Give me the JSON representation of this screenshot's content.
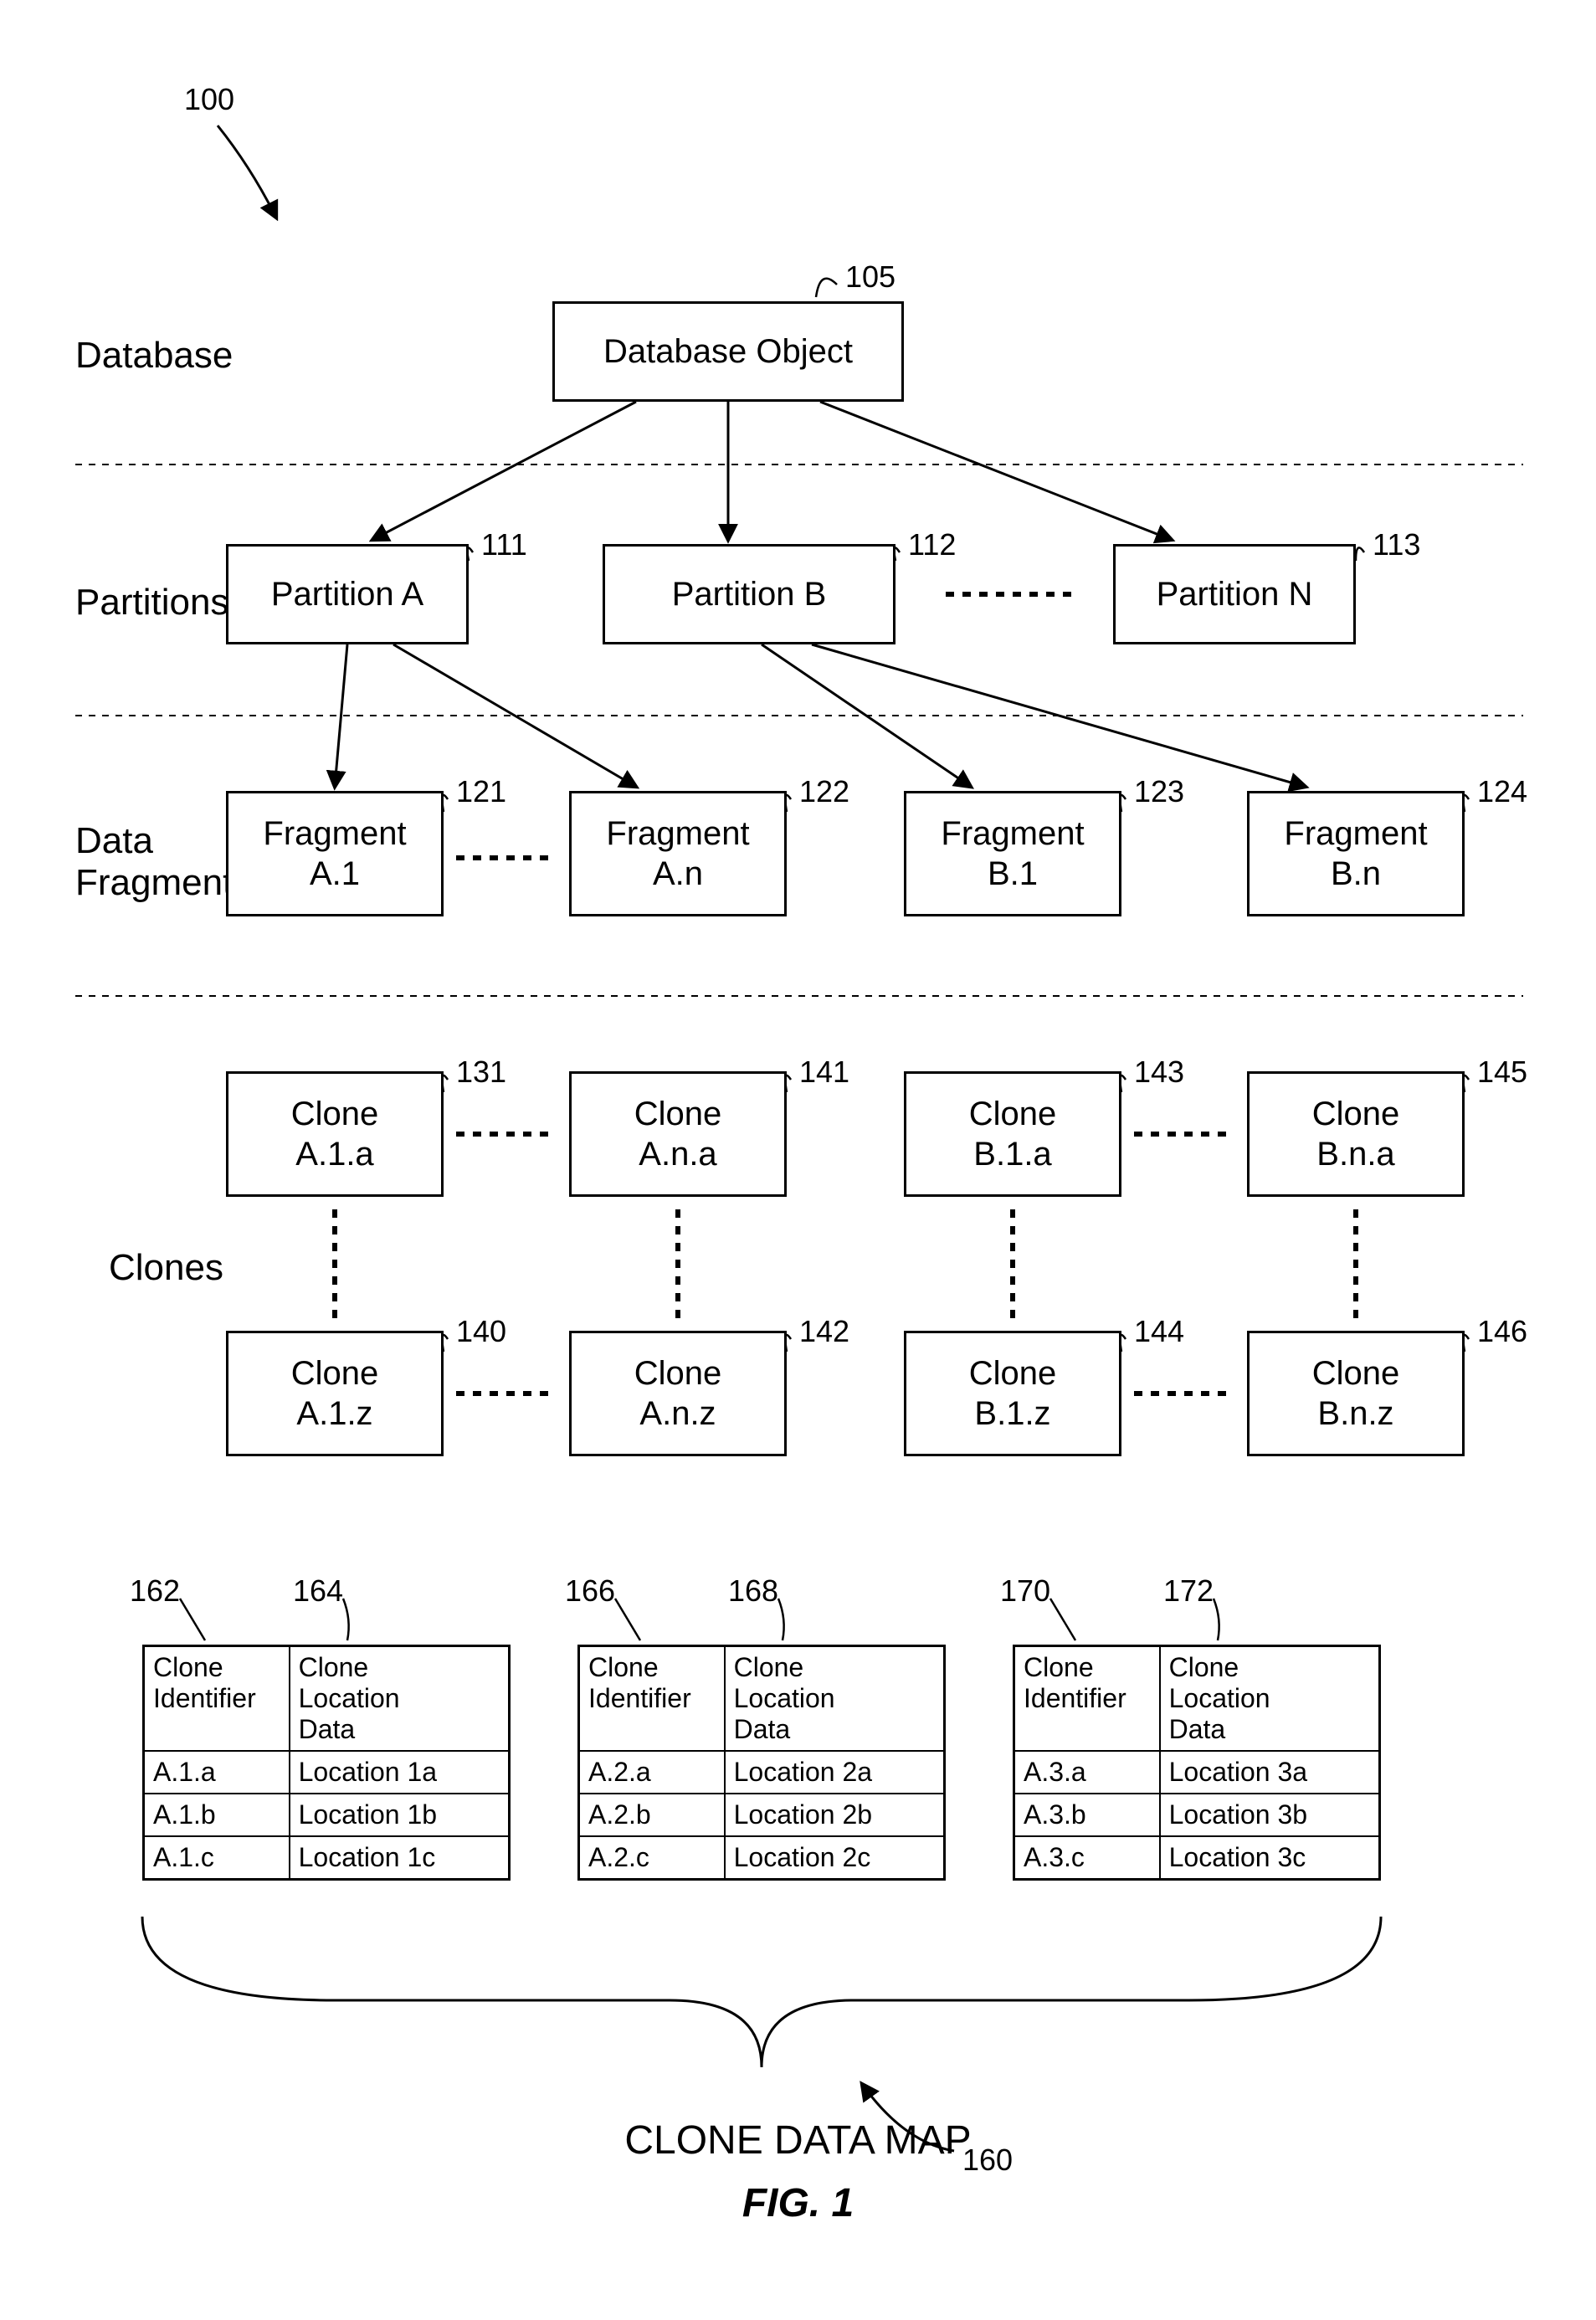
{
  "figure": {
    "ref_100": "100",
    "sections": {
      "database": "Database",
      "partitions": "Partitions",
      "dataFragments": "Data\nFragments",
      "clones": "Clones"
    },
    "nodes": {
      "db": {
        "label": "Database Object",
        "ref": "105"
      },
      "partA": {
        "label": "Partition A",
        "ref": "111"
      },
      "partB": {
        "label": "Partition B",
        "ref": "112"
      },
      "partN": {
        "label": "Partition N",
        "ref": "113"
      },
      "fragA1": {
        "label": "Fragment\nA.1",
        "ref": "121"
      },
      "fragAn": {
        "label": "Fragment\nA.n",
        "ref": "122"
      },
      "fragB1": {
        "label": "Fragment\nB.1",
        "ref": "123"
      },
      "fragBn": {
        "label": "Fragment\nB.n",
        "ref": "124"
      },
      "cA1a": {
        "label": "Clone\nA.1.a",
        "ref": "131"
      },
      "cAna": {
        "label": "Clone\nA.n.a",
        "ref": "141"
      },
      "cB1a": {
        "label": "Clone\nB.1.a",
        "ref": "143"
      },
      "cBna": {
        "label": "Clone\nB.n.a",
        "ref": "145"
      },
      "cA1z": {
        "label": "Clone\nA.1.z",
        "ref": "140"
      },
      "cAnz": {
        "label": "Clone\nA.n.z",
        "ref": "142"
      },
      "cB1z": {
        "label": "Clone\nB.1.z",
        "ref": "144"
      },
      "cBnz": {
        "label": "Clone\nB.n.z",
        "ref": "146"
      }
    },
    "tables": {
      "refs": {
        "t1c1": "162",
        "t1c2": "164",
        "t2c1": "166",
        "t2c2": "168",
        "t3c1": "170",
        "t3c2": "172"
      },
      "headers": {
        "id": "Clone\nIdentifier",
        "loc": "Clone\nLocation\nData"
      },
      "t1": [
        {
          "id": "A.1.a",
          "loc": "Location 1a"
        },
        {
          "id": "A.1.b",
          "loc": "Location 1b"
        },
        {
          "id": "A.1.c",
          "loc": "Location 1c"
        }
      ],
      "t2": [
        {
          "id": "A.2.a",
          "loc": "Location 2a"
        },
        {
          "id": "A.2.b",
          "loc": "Location 2b"
        },
        {
          "id": "A.2.c",
          "loc": "Location 2c"
        }
      ],
      "t3": [
        {
          "id": "A.3.a",
          "loc": "Location 3a"
        },
        {
          "id": "A.3.b",
          "loc": "Location 3b"
        },
        {
          "id": "A.3.c",
          "loc": "Location 3c"
        }
      ]
    },
    "cloneMap": {
      "label": "CLONE DATA MAP",
      "ref": "160"
    },
    "figLabel": "FIG. 1"
  }
}
